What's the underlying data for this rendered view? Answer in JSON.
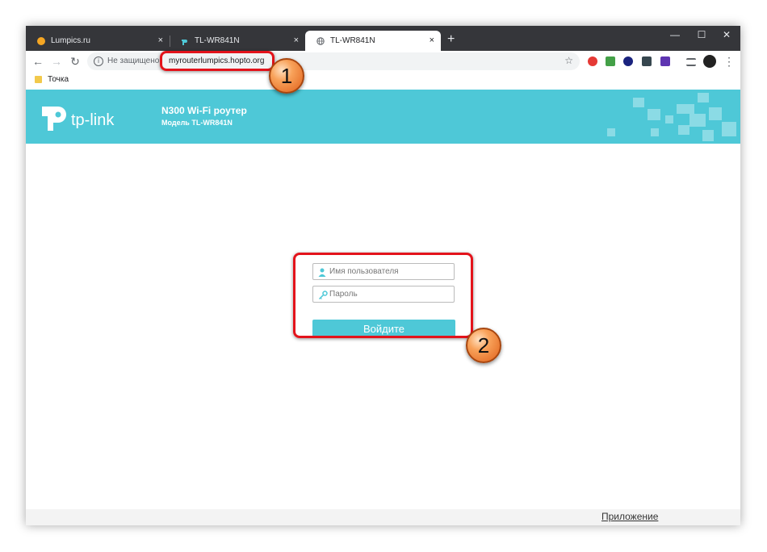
{
  "browser": {
    "tabs": [
      {
        "title": "Lumpics.ru",
        "icon": "lumpics-favicon"
      },
      {
        "title": "TL-WR841N",
        "icon": "tplink-favicon"
      },
      {
        "title": "TL-WR841N",
        "icon": "globe-icon"
      }
    ],
    "tab_close": "×",
    "new_tab": "+",
    "window_controls": {
      "minimize": "—",
      "maximize": "☐",
      "close": "✕"
    },
    "nav": {
      "back": "←",
      "forward": "→",
      "reload": "↻"
    },
    "address": {
      "security_label": "Не защищено",
      "url": "myrouterlumpics.hopto.org",
      "info_icon": "i"
    },
    "star": "☆",
    "menu_icon": "⋮",
    "bookmarks": [
      {
        "label": "Точка"
      }
    ]
  },
  "router": {
    "brand": "tp-link",
    "model_title": "N300 Wi-Fi роутер",
    "model_subtitle": "Модель TL-WR841N",
    "login": {
      "username_placeholder": "Имя пользователя",
      "password_placeholder": "Пароль",
      "submit_label": "Войдите"
    },
    "footer_link": "Приложение"
  },
  "annotations": [
    {
      "label": "1"
    },
    {
      "label": "2"
    }
  ],
  "colors": {
    "brand": "#4ec8d7",
    "highlight": "#e3131b",
    "badge": "#f08a3c"
  }
}
